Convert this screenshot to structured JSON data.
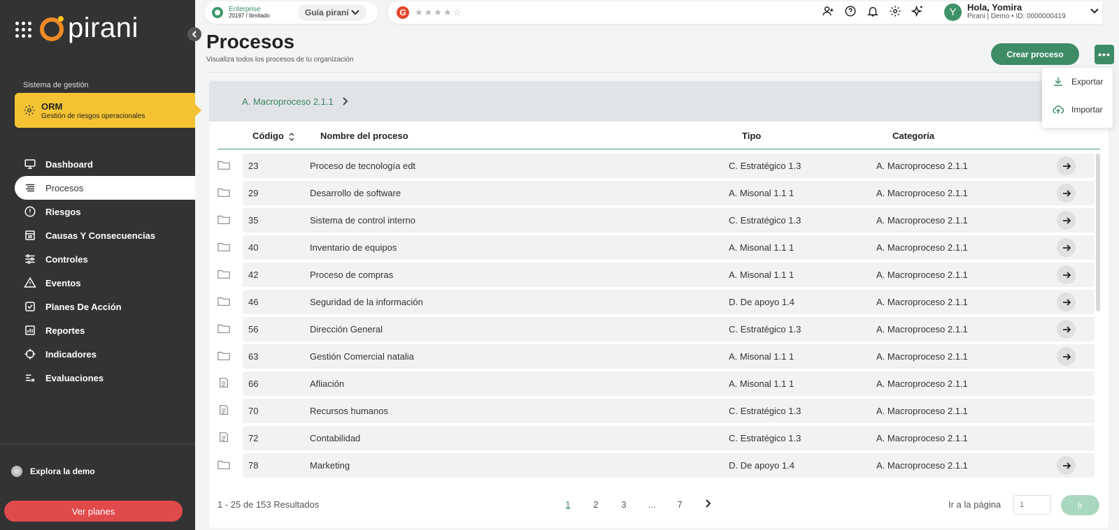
{
  "brand": {
    "name": "pirani"
  },
  "sidebar": {
    "system_label": "Sistema de gestión",
    "module": {
      "title": "ORM",
      "subtitle": "Gestión de riesgos operacionales",
      "color": "#f3c334"
    },
    "items": [
      {
        "label": "Dashboard",
        "icon": "monitor-icon"
      },
      {
        "label": "Procesos",
        "icon": "list-icon",
        "active": true
      },
      {
        "label": "Riesgos",
        "icon": "alert-circle-icon"
      },
      {
        "label": "Causas Y Consecuencias",
        "icon": "newspaper-icon"
      },
      {
        "label": "Controles",
        "icon": "sliders-icon"
      },
      {
        "label": "Eventos",
        "icon": "warning-triangle-icon"
      },
      {
        "label": "Planes De Acción",
        "icon": "checkbox-icon"
      },
      {
        "label": "Reportes",
        "icon": "chart-icon"
      },
      {
        "label": "Indicadores",
        "icon": "crosshair-icon"
      },
      {
        "label": "Evaluaciones",
        "icon": "checklist-icon"
      }
    ],
    "explore_label": "Explora la demo",
    "plans_button": "Ver planes",
    "plans_color": "#e14a4a"
  },
  "topbar": {
    "plan_name": "Enterprise",
    "plan_detail": "20197 / Ilimitado",
    "guide_label": "Guía pirani",
    "rating_stars": "★★★★☆",
    "user": {
      "initial": "Y",
      "greeting": "Hola, Yomira",
      "info": "Pirani | Demo • ID: 0000000419"
    }
  },
  "header": {
    "title": "Procesos",
    "subtitle": "Visualiza todos los procesos de tu organización",
    "create_button": "Crear proceso",
    "more_button": "•••",
    "accent": "#3e8c66"
  },
  "dropdown": {
    "export_label": "Exportar",
    "import_label": "Importar"
  },
  "breadcrumb": {
    "label": "A. Macroproceso 2.1.1"
  },
  "table": {
    "columns": {
      "code": "Código",
      "name": "Nombre del proceso",
      "type": "Tipo",
      "category": "Categoría"
    },
    "rows": [
      {
        "kind": "folder",
        "code": "23",
        "name": "Proceso de tecnología edt",
        "type": "C. Estratégico 1.3",
        "category": "A. Macroproceso 2.1.1",
        "has_arrow": true
      },
      {
        "kind": "folder",
        "code": "29",
        "name": "Desarrollo de software",
        "type": "A. Misonal 1.1 1",
        "category": "A. Macroproceso 2.1.1",
        "has_arrow": true
      },
      {
        "kind": "folder",
        "code": "35",
        "name": "Sistema de control interno",
        "type": "C. Estratégico 1.3",
        "category": "A. Macroproceso 2.1.1",
        "has_arrow": true
      },
      {
        "kind": "folder",
        "code": "40",
        "name": "Inventario de equipos",
        "type": "A. Misonal 1.1 1",
        "category": "A. Macroproceso 2.1.1",
        "has_arrow": true
      },
      {
        "kind": "folder",
        "code": "42",
        "name": "Proceso de compras",
        "type": "A. Misonal 1.1 1",
        "category": "A. Macroproceso 2.1.1",
        "has_arrow": true
      },
      {
        "kind": "folder",
        "code": "46",
        "name": "Seguridad de la información",
        "type": "D. De apoyo 1.4",
        "category": "A. Macroproceso 2.1.1",
        "has_arrow": true
      },
      {
        "kind": "folder",
        "code": "56",
        "name": "Dirección General",
        "type": "C. Estratégico 1.3",
        "category": "A. Macroproceso 2.1.1",
        "has_arrow": true
      },
      {
        "kind": "folder",
        "code": "63",
        "name": "Gestión Comercial natalia",
        "type": "A. Misonal 1.1 1",
        "category": "A. Macroproceso 2.1.1",
        "has_arrow": true
      },
      {
        "kind": "document",
        "code": "66",
        "name": "Afliación",
        "type": "A. Misonal 1.1 1",
        "category": "A. Macroproceso 2.1.1",
        "has_arrow": false
      },
      {
        "kind": "document",
        "code": "70",
        "name": "Recursos humanos",
        "type": "C. Estratégico 1.3",
        "category": "A. Macroproceso 2.1.1",
        "has_arrow": false
      },
      {
        "kind": "document",
        "code": "72",
        "name": "Contabilidad",
        "type": "C. Estratégico 1.3",
        "category": "A. Macroproceso 2.1.1",
        "has_arrow": false
      },
      {
        "kind": "folder",
        "code": "78",
        "name": "Marketing",
        "type": "D. De apoyo 1.4",
        "category": "A. Macroproceso 2.1.1",
        "has_arrow": true
      }
    ]
  },
  "pagination": {
    "results": "1 - 25 de 153 Resultados",
    "pages": [
      "1",
      "2",
      "3",
      "...",
      "7"
    ],
    "current": "1",
    "goto_label": "Ir a la página",
    "goto_placeholder": "1",
    "go_button": "Ir"
  }
}
